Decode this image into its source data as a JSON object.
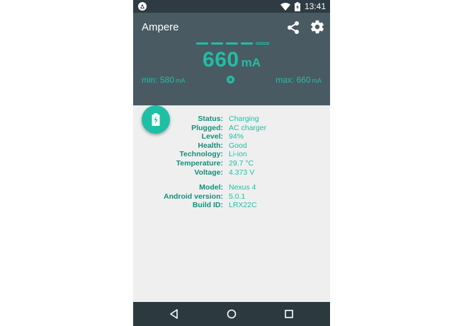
{
  "statusbar": {
    "time": "13:41",
    "icons": [
      "android-notification-icon",
      "wifi-icon",
      "battery-charging-icon"
    ]
  },
  "header": {
    "title": "Ampere",
    "current_value": "660",
    "current_unit": "mA",
    "min_label": "min: 580",
    "min_unit": "mA",
    "max_label": "max: 660",
    "max_unit": "mA",
    "level_bars": {
      "filled": 4,
      "total": 5
    },
    "icons": [
      "share-icon",
      "gear-icon",
      "reset-icon"
    ]
  },
  "info": {
    "battery": [
      {
        "key": "Status:",
        "value": "Charging"
      },
      {
        "key": "Plugged:",
        "value": "AC charger"
      },
      {
        "key": "Level:",
        "value": "94%"
      },
      {
        "key": "Health:",
        "value": "Good"
      },
      {
        "key": "Technology:",
        "value": "Li-ion"
      },
      {
        "key": "Temperature:",
        "value": "29.7 °C"
      },
      {
        "key": "Voltage:",
        "value": "4.373 V"
      }
    ],
    "device": [
      {
        "key": "Model:",
        "value": "Nexus 4"
      },
      {
        "key": "Android version:",
        "value": "5.0.1"
      },
      {
        "key": "Build ID:",
        "value": "LRX22C"
      }
    ]
  },
  "colors": {
    "accent": "#1fbfa5",
    "header": "#4a5a63",
    "statusbar": "#2e3b42",
    "navbar": "#2c3a40",
    "body": "#efefef"
  },
  "navbar": {
    "icons": [
      "back-icon",
      "home-icon",
      "recents-icon"
    ]
  }
}
